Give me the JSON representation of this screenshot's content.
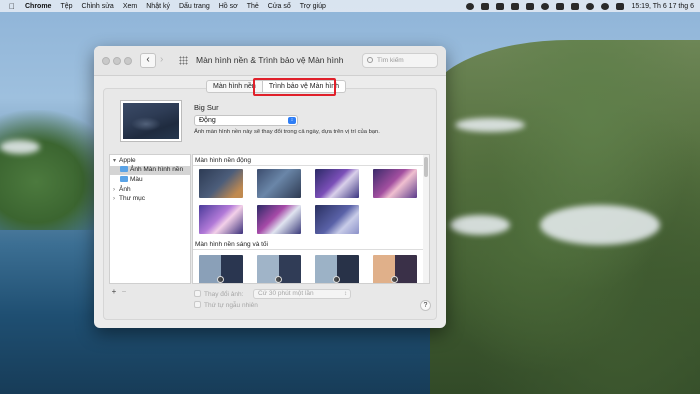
{
  "menubar": {
    "app_name": "Chrome",
    "items": [
      "Tệp",
      "Chỉnh sửa",
      "Xem",
      "Nhật ký",
      "Dấu trang",
      "Hồ sơ",
      "Thẻ",
      "Cửa sổ",
      "Trợ giúp"
    ],
    "clock": "15:19, Th 6 17 thg 6"
  },
  "window": {
    "title": "Màn hình nền & Trình bảo vệ Màn hình",
    "search_placeholder": "Tìm kiếm"
  },
  "tabs": [
    {
      "label": "Màn hình nền",
      "active": true
    },
    {
      "label": "Trình bảo vệ Màn hình",
      "active": false
    }
  ],
  "wallpaper": {
    "name": "Big Sur",
    "mode": "Động",
    "description": "Ảnh màn hình nền này sẽ thay đổi trong cả ngày, dựa trên vị trí của bạn."
  },
  "sidebar": {
    "group": "Apple",
    "items": [
      "Ảnh Màn hình nền",
      "Màu"
    ],
    "extra": [
      "Ảnh",
      "Thư mục"
    ],
    "add_label": "+",
    "remove_label": "−"
  },
  "gallery": {
    "section1": "Màn hình nền động",
    "section2": "Màn hình nền sáng và tối"
  },
  "options": {
    "change_picture": "Thay đổi ảnh:",
    "interval": "Cứ 30 phút một lần",
    "random_order": "Thứ tự ngẫu nhiên",
    "help": "?"
  },
  "colors": {
    "highlight_box": "#e0202a",
    "accent": "#2e7ef6"
  }
}
